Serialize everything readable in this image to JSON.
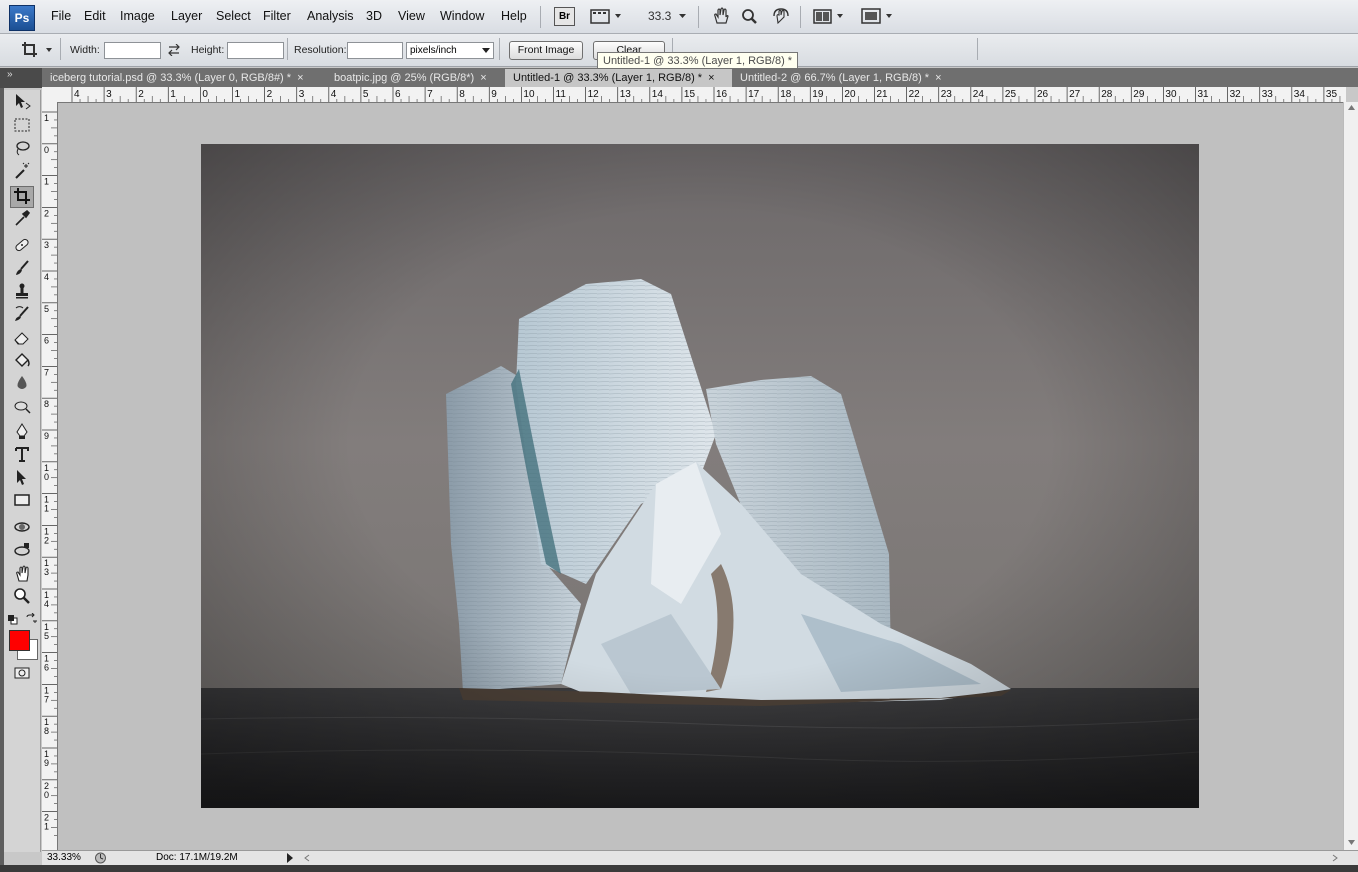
{
  "app": {
    "logo": "Ps"
  },
  "menu": [
    "File",
    "Edit",
    "Image",
    "Layer",
    "Select",
    "Filter",
    "Analysis",
    "3D",
    "View",
    "Window",
    "Help"
  ],
  "apptoolbar": {
    "bridge": "Br",
    "zoom": "33.3"
  },
  "options": {
    "width_label": "Width:",
    "width_value": "",
    "height_label": "Height:",
    "height_value": "",
    "resolution_label": "Resolution:",
    "resolution_value": "",
    "units": "pixels/inch",
    "front_image": "Front Image",
    "clear": "Clear"
  },
  "tooltip": "Untitled-1 @ 33.3% (Layer 1, RGB/8) *",
  "tabs": [
    {
      "label": "iceberg tutorial.psd @ 33.3% (Layer 0, RGB/8#) *",
      "close": "×",
      "active": false
    },
    {
      "label": "boatpic.jpg @ 25% (RGB/8*)",
      "close": "×",
      "active": false
    },
    {
      "label": "Untitled-1 @ 33.3% (Layer 1, RGB/8) *",
      "close": "×",
      "active": true
    },
    {
      "label": "Untitled-2 @ 66.7% (Layer 1, RGB/8) *",
      "close": "×",
      "active": false
    }
  ],
  "ruler_top": [
    "4",
    "3",
    "2",
    "1",
    "0",
    "1",
    "2",
    "3",
    "4",
    "5",
    "6",
    "7",
    "8",
    "9",
    "10",
    "11",
    "12",
    "13",
    "14",
    "15",
    "16",
    "17",
    "18",
    "19",
    "20",
    "21",
    "22",
    "23",
    "24",
    "25",
    "26",
    "27",
    "28",
    "29",
    "30",
    "31",
    "32",
    "33",
    "34",
    "35"
  ],
  "ruler_left": [
    "1",
    "0",
    "1",
    "2",
    "3",
    "4",
    "5",
    "6",
    "7",
    "8",
    "9",
    "1 0",
    "1 1",
    "1 2",
    "1 3",
    "1 4",
    "1 5",
    "1 6",
    "1 7",
    "1 8",
    "1 9",
    "2 0",
    "2 1"
  ],
  "status": {
    "zoom": "33.33%",
    "doc": "Doc: 17.1M/19.2M"
  },
  "colors": {
    "foreground": "#ff0000",
    "background": "#ffffff"
  },
  "icons": [
    "move-icon",
    "marquee-icon",
    "lasso-icon",
    "magic-wand-icon",
    "crop-icon",
    "eyedropper-icon",
    "healing-brush-icon",
    "brush-icon",
    "clone-stamp-icon",
    "history-brush-icon",
    "eraser-icon",
    "paint-bucket-icon",
    "blur-icon",
    "dodge-icon",
    "pen-icon",
    "type-icon",
    "path-selection-icon",
    "rectangle-icon",
    "3d-rotate-icon",
    "3d-orbit-icon",
    "hand-icon",
    "zoom-icon"
  ]
}
